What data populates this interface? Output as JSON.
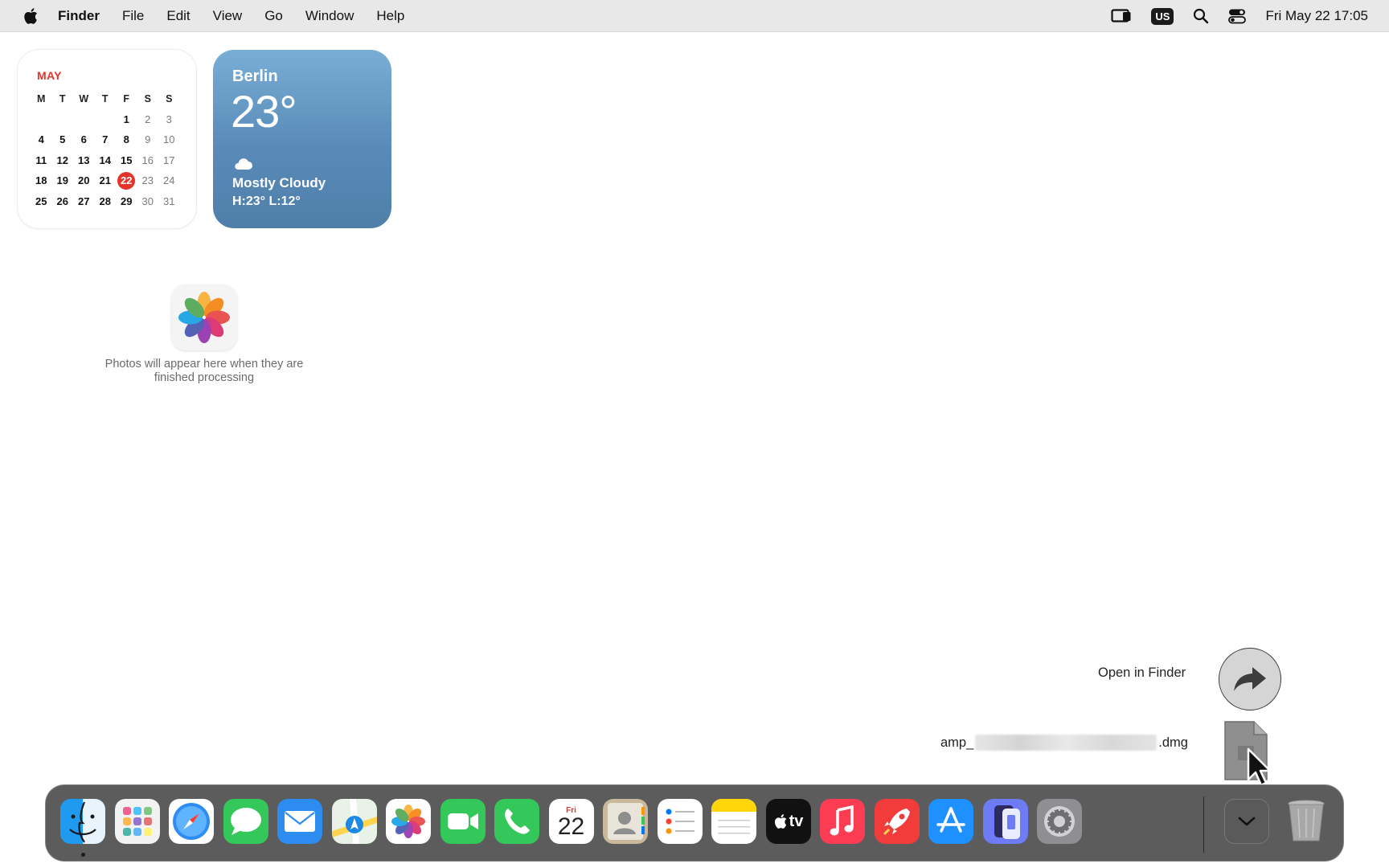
{
  "menubar": {
    "app_name": "Finder",
    "items": [
      "File",
      "Edit",
      "View",
      "Go",
      "Window",
      "Help"
    ],
    "input_source": "US",
    "datetime": "Fri May 22  17:05"
  },
  "calendar_widget": {
    "month": "MAY",
    "weekday_headers": [
      "M",
      "T",
      "W",
      "T",
      "F",
      "S",
      "S"
    ],
    "weeks": [
      [
        "",
        "",
        "",
        "",
        "1",
        "2",
        "3"
      ],
      [
        "4",
        "5",
        "6",
        "7",
        "8",
        "9",
        "10"
      ],
      [
        "11",
        "12",
        "13",
        "14",
        "15",
        "16",
        "17"
      ],
      [
        "18",
        "19",
        "20",
        "21",
        "22",
        "23",
        "24"
      ],
      [
        "25",
        "26",
        "27",
        "28",
        "29",
        "30",
        "31"
      ]
    ],
    "today": "22",
    "accent_color": "#e5332a"
  },
  "weather_widget": {
    "city": "Berlin",
    "temperature": "23°",
    "condition": "Mostly Cloudy",
    "high_low": "H:23° L:12°",
    "icon": "cloud-icon"
  },
  "photos_widget": {
    "icon": "photos-app-icon",
    "message": "Photos will appear here when they are finished processing"
  },
  "downloads_stack": {
    "open_in_finder_label": "Open in Finder",
    "file_name_prefix": "amp_",
    "file_name_suffix": ".dmg",
    "file_icon": "dmg-file-icon"
  },
  "dock": {
    "apps": [
      {
        "name": "Finder",
        "icon": "finder-icon",
        "running": true
      },
      {
        "name": "Launchpad",
        "icon": "launchpad-icon",
        "running": false
      },
      {
        "name": "Safari",
        "icon": "safari-icon",
        "running": false
      },
      {
        "name": "Messages",
        "icon": "messages-icon",
        "running": false
      },
      {
        "name": "Mail",
        "icon": "mail-icon",
        "running": false
      },
      {
        "name": "Maps",
        "icon": "maps-icon",
        "running": false
      },
      {
        "name": "Photos",
        "icon": "photos-icon",
        "running": false
      },
      {
        "name": "FaceTime",
        "icon": "facetime-icon",
        "running": false
      },
      {
        "name": "Phone",
        "icon": "phone-icon",
        "running": false
      },
      {
        "name": "Calendar",
        "icon": "calendar-icon",
        "running": false,
        "day_label": "Fri",
        "date_label": "22"
      },
      {
        "name": "Contacts",
        "icon": "contacts-icon",
        "running": false
      },
      {
        "name": "Reminders",
        "icon": "reminders-icon",
        "running": false
      },
      {
        "name": "Notes",
        "icon": "notes-icon",
        "running": false
      },
      {
        "name": "TV",
        "icon": "tv-icon",
        "running": false,
        "label": "tv"
      },
      {
        "name": "Music",
        "icon": "music-icon",
        "running": false
      },
      {
        "name": "Rocket",
        "icon": "rocket-icon",
        "running": false
      },
      {
        "name": "App Store",
        "icon": "app-store-icon",
        "running": false
      },
      {
        "name": "iPhone Mirroring",
        "icon": "iphone-mirroring-icon",
        "running": false
      },
      {
        "name": "System Settings",
        "icon": "system-settings-icon",
        "running": false
      }
    ],
    "stack": {
      "name": "Downloads",
      "icon": "chevron-down-icon"
    },
    "trash": {
      "name": "Trash",
      "icon": "trash-icon"
    }
  }
}
